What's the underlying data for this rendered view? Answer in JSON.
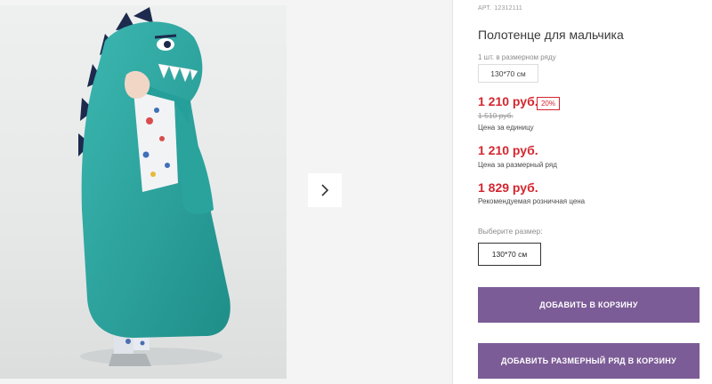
{
  "product": {
    "sku_label": "АРТ.",
    "sku": "12312111",
    "title": "Полотенце для мальчика",
    "pack_note": "1 шт. в размерном ряду",
    "pack_size": "130*70 см"
  },
  "pricing": {
    "price": "1 210 руб.",
    "discount": "20%",
    "old_price": "1 510 руб.",
    "price_caption": "Цена за единицу",
    "row_price": "1 210 руб.",
    "row_caption": "Цена за размерный ряд",
    "retail_price": "1 829 руб.",
    "retail_caption": "Рекомендуемая розничная цена"
  },
  "size_selector": {
    "label": "Выберите размер:",
    "selected": "130*70 см"
  },
  "actions": {
    "add_to_cart": "ДОБАВИТЬ В КОРЗИНУ",
    "add_row_to_cart": "ДОБАВИТЬ РАЗМЕРНЫЙ РЯД В КОРЗИНУ"
  },
  "colors": {
    "accent": "#7c5c96",
    "price_red": "#d4262f",
    "towel_teal": "#2fa9a3"
  },
  "icons": {
    "next": "chevron-right-icon"
  }
}
